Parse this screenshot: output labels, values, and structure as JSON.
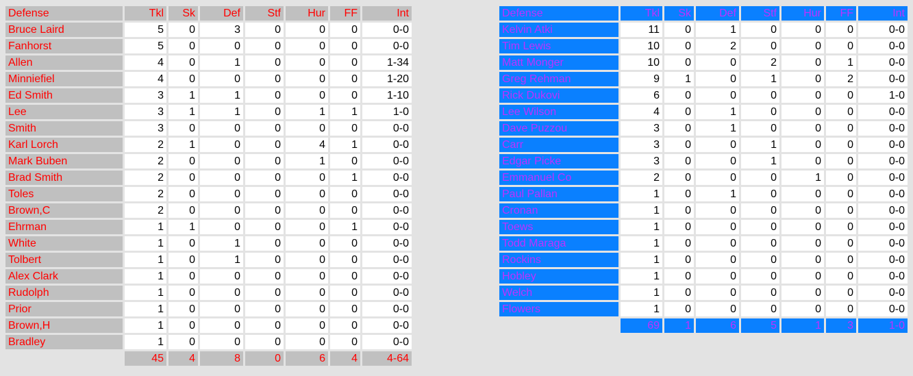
{
  "columns": [
    "Defense",
    "Tkl",
    "Sk",
    "Def",
    "Stf",
    "Hur",
    "FF",
    "Int"
  ],
  "colors": {
    "left_header_bg": "#c0c0c0",
    "left_text": "#ff0000",
    "right_header_bg": "#0a80ff",
    "right_text": "#c030ff",
    "cell_bg": "#ffffff",
    "page_bg": "#e3e3e3"
  },
  "left_team": {
    "rows": [
      [
        "Bruce Laird",
        "5",
        "0",
        "3",
        "0",
        "0",
        "0",
        "0-0"
      ],
      [
        "Fanhorst",
        "5",
        "0",
        "0",
        "0",
        "0",
        "0",
        "0-0"
      ],
      [
        "Allen",
        "4",
        "0",
        "1",
        "0",
        "0",
        "0",
        "1-34"
      ],
      [
        "Minniefiel",
        "4",
        "0",
        "0",
        "0",
        "0",
        "0",
        "1-20"
      ],
      [
        "Ed Smith",
        "3",
        "1",
        "1",
        "0",
        "0",
        "0",
        "1-10"
      ],
      [
        "Lee",
        "3",
        "1",
        "1",
        "0",
        "1",
        "1",
        "1-0"
      ],
      [
        "Smith",
        "3",
        "0",
        "0",
        "0",
        "0",
        "0",
        "0-0"
      ],
      [
        "Karl Lorch",
        "2",
        "1",
        "0",
        "0",
        "4",
        "1",
        "0-0"
      ],
      [
        "Mark Buben",
        "2",
        "0",
        "0",
        "0",
        "1",
        "0",
        "0-0"
      ],
      [
        "Brad Smith",
        "2",
        "0",
        "0",
        "0",
        "0",
        "1",
        "0-0"
      ],
      [
        "Toles",
        "2",
        "0",
        "0",
        "0",
        "0",
        "0",
        "0-0"
      ],
      [
        "Brown,C",
        "2",
        "0",
        "0",
        "0",
        "0",
        "0",
        "0-0"
      ],
      [
        "Ehrman",
        "1",
        "1",
        "0",
        "0",
        "0",
        "1",
        "0-0"
      ],
      [
        "White",
        "1",
        "0",
        "1",
        "0",
        "0",
        "0",
        "0-0"
      ],
      [
        "Tolbert",
        "1",
        "0",
        "1",
        "0",
        "0",
        "0",
        "0-0"
      ],
      [
        "Alex Clark",
        "1",
        "0",
        "0",
        "0",
        "0",
        "0",
        "0-0"
      ],
      [
        "Rudolph",
        "1",
        "0",
        "0",
        "0",
        "0",
        "0",
        "0-0"
      ],
      [
        "Prior",
        "1",
        "0",
        "0",
        "0",
        "0",
        "0",
        "0-0"
      ],
      [
        "Brown,H",
        "1",
        "0",
        "0",
        "0",
        "0",
        "0",
        "0-0"
      ],
      [
        "Bradley",
        "1",
        "0",
        "0",
        "0",
        "0",
        "0",
        "0-0"
      ]
    ],
    "totals": [
      "45",
      "4",
      "8",
      "0",
      "6",
      "4",
      "4-64"
    ]
  },
  "right_team": {
    "rows": [
      [
        "Kelvin Atki",
        "11",
        "0",
        "1",
        "0",
        "0",
        "0",
        "0-0"
      ],
      [
        "Tim Lewis",
        "10",
        "0",
        "2",
        "0",
        "0",
        "0",
        "0-0"
      ],
      [
        "Matt Monger",
        "10",
        "0",
        "0",
        "2",
        "0",
        "1",
        "0-0"
      ],
      [
        "Greg Rehman",
        "9",
        "1",
        "0",
        "1",
        "0",
        "2",
        "0-0"
      ],
      [
        "Rick Dukovi",
        "6",
        "0",
        "0",
        "0",
        "0",
        "0",
        "1-0"
      ],
      [
        "Lee Wilson",
        "4",
        "0",
        "1",
        "0",
        "0",
        "0",
        "0-0"
      ],
      [
        "Dave Puzzou",
        "3",
        "0",
        "1",
        "0",
        "0",
        "0",
        "0-0"
      ],
      [
        "Carr",
        "3",
        "0",
        "0",
        "1",
        "0",
        "0",
        "0-0"
      ],
      [
        "Edgar Picke",
        "3",
        "0",
        "0",
        "1",
        "0",
        "0",
        "0-0"
      ],
      [
        "Emmanuel Co",
        "2",
        "0",
        "0",
        "0",
        "1",
        "0",
        "0-0"
      ],
      [
        "Paul Pallan",
        "1",
        "0",
        "1",
        "0",
        "0",
        "0",
        "0-0"
      ],
      [
        "Cronan",
        "1",
        "0",
        "0",
        "0",
        "0",
        "0",
        "0-0"
      ],
      [
        "Toews",
        "1",
        "0",
        "0",
        "0",
        "0",
        "0",
        "0-0"
      ],
      [
        "Todd Maraga",
        "1",
        "0",
        "0",
        "0",
        "0",
        "0",
        "0-0"
      ],
      [
        "Rockins",
        "1",
        "0",
        "0",
        "0",
        "0",
        "0",
        "0-0"
      ],
      [
        "Hobley",
        "1",
        "0",
        "0",
        "0",
        "0",
        "0",
        "0-0"
      ],
      [
        "Welch",
        "1",
        "0",
        "0",
        "0",
        "0",
        "0",
        "0-0"
      ],
      [
        "Flowers",
        "1",
        "0",
        "0",
        "0",
        "0",
        "0",
        "0-0"
      ]
    ],
    "totals": [
      "69",
      "1",
      "6",
      "5",
      "1",
      "3",
      "1-0"
    ]
  }
}
